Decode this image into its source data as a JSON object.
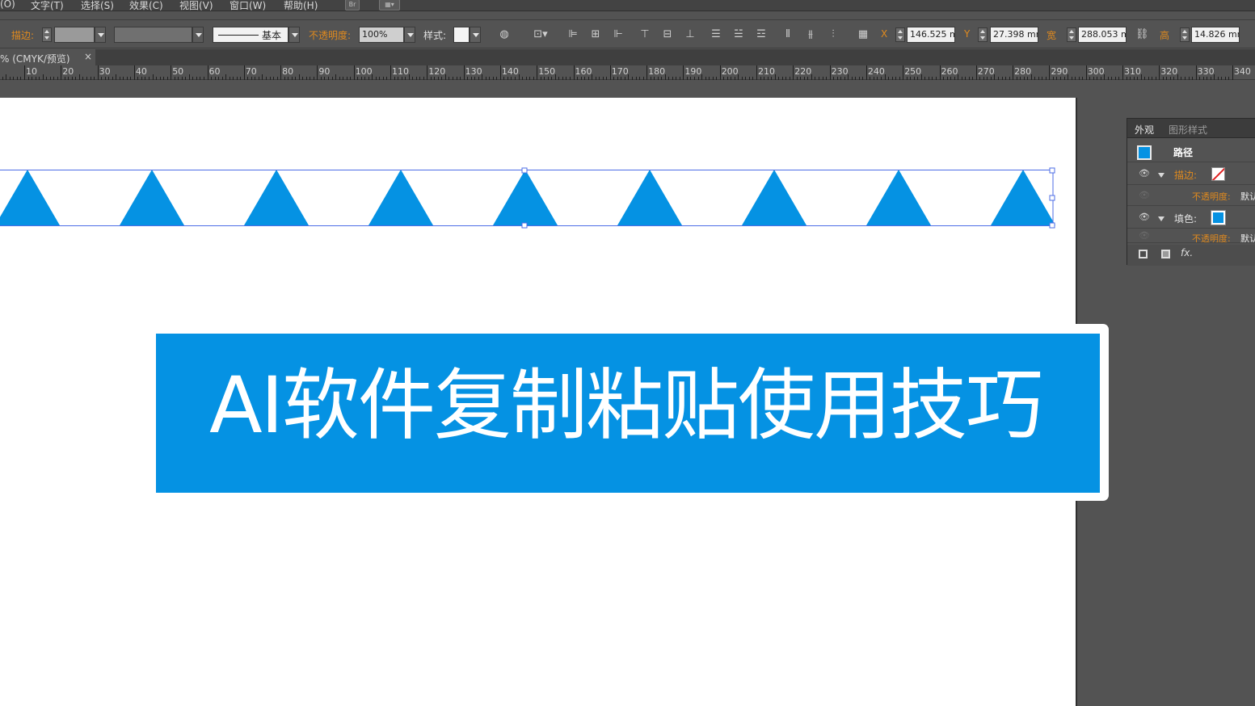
{
  "menu": {
    "items": [
      "(O)",
      "文字(T)",
      "选择(S)",
      "效果(C)",
      "视图(V)",
      "窗口(W)",
      "帮助(H)"
    ],
    "bridge_icon_label": "Br"
  },
  "control_bar": {
    "stroke_label": "描边:",
    "stroke_style_label": "基本",
    "opacity_label": "不透明度:",
    "opacity_value": "100%",
    "style_label": "样式:",
    "x_label": "X",
    "x_value": "146.525 m",
    "y_label": "Y",
    "y_value": "27.398 mm",
    "w_label": "宽",
    "w_value": "288.053 m",
    "h_label": "高",
    "h_value": "14.826 mm",
    "accent_color": "#e08a1e"
  },
  "document_tab": {
    "title": "% (CMYK/预览)",
    "close_glyph": "×"
  },
  "ruler": {
    "labels": [
      "10",
      "20",
      "30",
      "40",
      "50",
      "60",
      "70",
      "80",
      "90",
      "100",
      "110",
      "120",
      "130",
      "140",
      "150",
      "160",
      "170",
      "180",
      "190",
      "200",
      "210",
      "220",
      "230",
      "240",
      "250",
      "260",
      "270",
      "280",
      "290",
      "300",
      "310",
      "320",
      "330",
      "340"
    ]
  },
  "artwork": {
    "shape_color": "#0592e3",
    "selection_color": "#4c6ce6",
    "triangle_count": 9
  },
  "banner": {
    "title": "AI软件复制粘贴使用技巧",
    "background_color": "#0592e3",
    "text_color": "#ffffff"
  },
  "appearance_panel": {
    "tab_active": "外观",
    "tab_inactive": "图形样式",
    "object_label": "路径",
    "stroke_label": "描边:",
    "stroke_opacity_label": "不透明度:",
    "stroke_opacity_value": "默认",
    "fill_label": "填色:",
    "fill_opacity_label": "不透明度:",
    "fill_opacity_value": "默认",
    "fx_label": "fx.",
    "fill_color": "#0592e3"
  }
}
